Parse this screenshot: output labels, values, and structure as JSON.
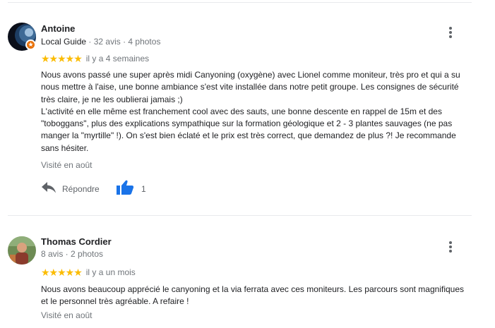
{
  "reviews": [
    {
      "author": "Antoine",
      "local_guide_label": "Local Guide",
      "stats": "· 32 avis · 4 photos",
      "stars": "★★★★★",
      "time": "il y a 4 semaines",
      "paragraphs": [
        "Nous avons passé une super après midi Canyoning (oxygène) avec Lionel comme moniteur, très pro et qui a su nous mettre à l'aise, une bonne ambiance s'est vite installée dans notre petit groupe. Les consignes de sécurité très claire, je ne les oublierai jamais ;)",
        "L'activité en elle même est franchement cool avec des sauts, une bonne descente en rappel de 15m et des \"toboggans\", plus des explications sympathique sur la formation géologique et 2 - 3 plantes sauvages (ne pas manger la \"myrtille\" !). On s'est bien éclaté et le prix est très correct, que demandez de plus ?! Je recommande sans hésiter."
      ],
      "visited": "Visité en août",
      "reply_label": "Répondre",
      "like_count": "1"
    },
    {
      "author": "Thomas Cordier",
      "stats": "8 avis · 2 photos",
      "stars": "★★★★★",
      "time": "il y a un mois",
      "paragraphs": [
        "Nous avons beaucoup apprécié le canyoning et la via ferrata avec ces moniteurs. Les parcours sont magnifiques et le personnel très agréable. A refaire !"
      ],
      "visited": "Visité en août"
    }
  ],
  "icons": {
    "more": "more-vert-icon",
    "reply": "reply-icon",
    "like": "thumbs-up-icon",
    "local_guide_badge": "local-guide-star-icon"
  },
  "colors": {
    "star": "#fbbc04",
    "like": "#1a73e8",
    "badge": "#e8710a"
  }
}
